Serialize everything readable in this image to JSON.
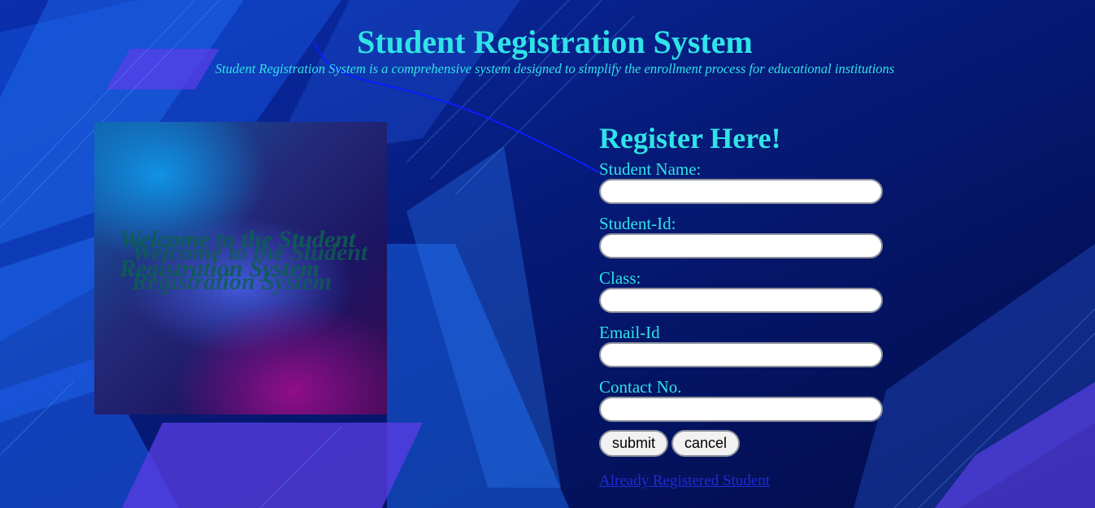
{
  "header": {
    "title": "Student Registration System",
    "subtitle": "Student Registration System is a comprehensive system designed to simplify the enrollment process for educational institutions"
  },
  "welcome": {
    "text_lines": [
      "Welcome to the Student",
      "Registration System"
    ]
  },
  "form": {
    "title": "Register Here!",
    "fields": [
      {
        "label": "Student Name:",
        "value": "",
        "placeholder": ""
      },
      {
        "label": "Student-Id:",
        "value": "",
        "placeholder": ""
      },
      {
        "label": "Class:",
        "value": "",
        "placeholder": ""
      },
      {
        "label": "Email-Id",
        "value": "",
        "placeholder": ""
      },
      {
        "label": "Contact No.",
        "value": "",
        "placeholder": ""
      }
    ],
    "submit_label": "submit",
    "cancel_label": "cancel",
    "link_label": "Already Registered Student"
  },
  "colors": {
    "accent": "#2fe3e6",
    "background": "#04135a",
    "link": "#1f2bd6",
    "welcome_text": "#0d5e52"
  }
}
